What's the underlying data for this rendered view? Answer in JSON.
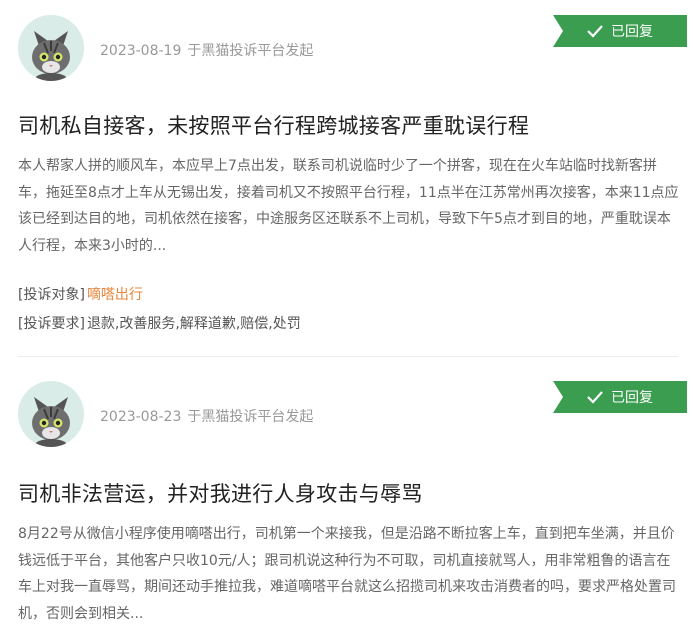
{
  "complaints": [
    {
      "date": "2023-08-19",
      "source": "于黑猫投诉平台发起",
      "status": "已回复",
      "title": "司机私自接客，未按照平台行程跨城接客严重耽误行程",
      "body": "本人帮家人拼的顺风车，本应早上7点出发，联系司机说临时少了一个拼客，现在在火车站临时找新客拼车，拖延至8点才上车从无锡出发，接着司机又不按照平台行程，11点半在江苏常州再次接客，本来11点应该已经到达目的地，司机依然在接客，中途服务区还联系不上司机，导致下午5点才到目的地，严重耽误本人行程，本来3小时的...",
      "target_label": "[投诉对象]",
      "target_value": "嘀嗒出行",
      "demand_label": "[投诉要求]",
      "demand_value": "退款,改善服务,解释道歉,赔偿,处罚"
    },
    {
      "date": "2023-08-23",
      "source": "于黑猫投诉平台发起",
      "status": "已回复",
      "title": "司机非法营运，并对我进行人身攻击与辱骂",
      "body": "8月22号从微信小程序使用嘀嗒出行，司机第一个来接我，但是沿路不断拉客上车，直到把车坐满，并且价钱远低于平台，其他客户只收10元/人；跟司机说这种行为不可取，司机直接就骂人，用非常粗鲁的语言在车上对我一直辱骂，期间还动手推拉我，难道嘀嗒平台就这么招揽司机来攻击消费者的吗，要求严格处置司机，否则会到相关..."
    }
  ],
  "colors": {
    "badge": "#3a9d4f",
    "company": "#e8853a"
  }
}
